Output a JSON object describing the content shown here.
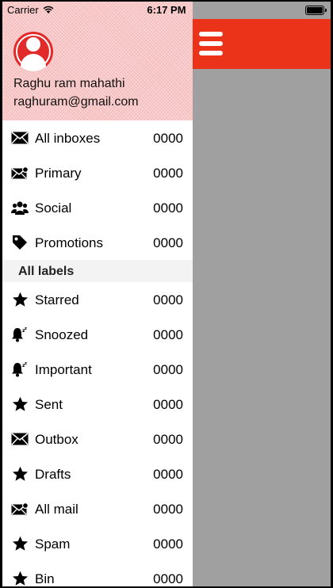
{
  "status_bar": {
    "carrier": "Carrier",
    "time": "6:17 PM"
  },
  "toolbar": {
    "accent_color": "#ea3319",
    "menu_icon": "hamburger-icon"
  },
  "profile": {
    "name": "Raghu ram mahathi",
    "email": "raghuram@gmail.com",
    "header_color": "#f6bcbc",
    "avatar_color": "#e22a2a"
  },
  "primary_items": [
    {
      "label": "All inboxes",
      "count": "0000",
      "icon": "envelope-icon"
    },
    {
      "label": "Primary",
      "count": "0000",
      "icon": "envelope-badge-icon"
    },
    {
      "label": "Social",
      "count": "0000",
      "icon": "people-icon"
    },
    {
      "label": "Promotions",
      "count": "0000",
      "icon": "tag-icon"
    }
  ],
  "section_title": "All labels",
  "label_items": [
    {
      "label": "Starred",
      "count": "0000",
      "icon": "star-icon"
    },
    {
      "label": "Snoozed",
      "count": "0000",
      "icon": "snooze-bell-icon"
    },
    {
      "label": "Important",
      "count": "0000",
      "icon": "snooze-bell-icon"
    },
    {
      "label": "Sent",
      "count": "0000",
      "icon": "star-icon"
    },
    {
      "label": "Outbox",
      "count": "0000",
      "icon": "envelope-icon"
    },
    {
      "label": "Drafts",
      "count": "0000",
      "icon": "star-icon"
    },
    {
      "label": "All mail",
      "count": "0000",
      "icon": "envelope-badge-icon"
    },
    {
      "label": "Spam",
      "count": "0000",
      "icon": "star-icon"
    },
    {
      "label": "Bin",
      "count": "0000",
      "icon": "star-icon"
    }
  ]
}
